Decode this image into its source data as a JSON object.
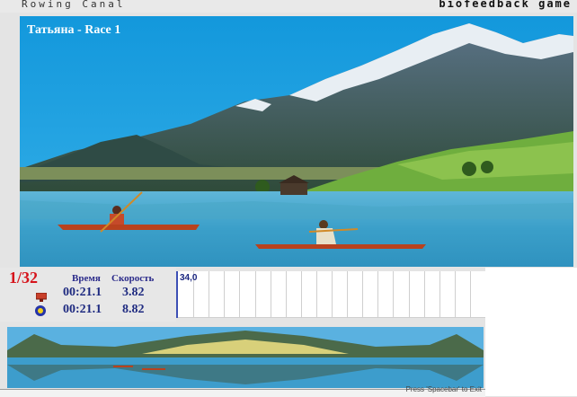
{
  "app": {
    "title": "Rowing Canal",
    "brand": "biofeedback game"
  },
  "scene": {
    "race_label": "Татьяна - Race 1"
  },
  "stats": {
    "position": "1/32",
    "time_header": "Время",
    "speed_header": "Скорость",
    "rows": [
      {
        "icon": "monitor-icon",
        "time": "00:21.1",
        "speed": "3.82"
      },
      {
        "icon": "player-icon",
        "time": "00:21.1",
        "speed": "8.82"
      }
    ]
  },
  "graph": {
    "value_label": "34,0",
    "grid_columns": 20
  },
  "status": {
    "hint": "Press 'Spacebar' to Exit"
  },
  "colors": {
    "sky": "#1e9fdc",
    "water": "#3fa6d4",
    "canoe": "#b8421e",
    "accent_red": "#d6141c",
    "text_blue": "#1e2a80"
  }
}
